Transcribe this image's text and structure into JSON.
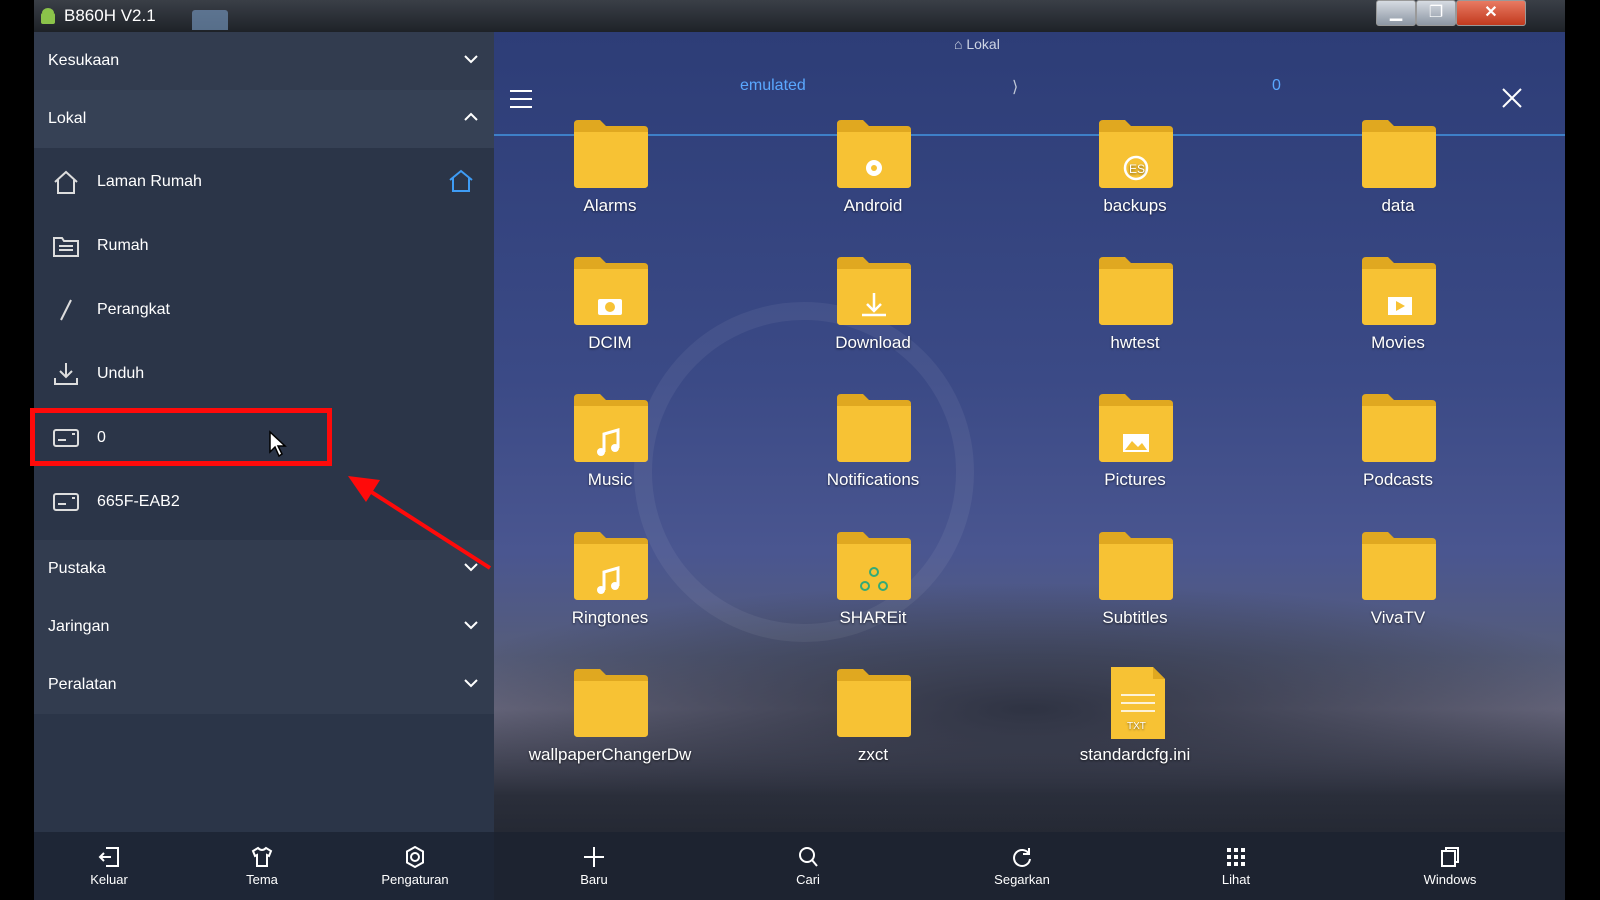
{
  "window": {
    "title": "B860H V2.1",
    "controls": {
      "minimize": "▁",
      "maximize": "❐",
      "close": "✕"
    }
  },
  "sidebar": {
    "sections": [
      {
        "label": "Kesukaan",
        "expanded": false
      },
      {
        "label": "Lokal",
        "expanded": true
      },
      {
        "label": "Pustaka",
        "expanded": false
      },
      {
        "label": "Jaringan",
        "expanded": false
      },
      {
        "label": "Peralatan",
        "expanded": false
      }
    ],
    "items": [
      {
        "label": "Laman Rumah",
        "icon": "home-icon"
      },
      {
        "label": "Rumah",
        "icon": "folder-list-icon"
      },
      {
        "label": "Perangkat",
        "icon": "slash-icon"
      },
      {
        "label": "Unduh",
        "icon": "download-icon"
      },
      {
        "label": "0",
        "icon": "storage-icon",
        "highlighted": true
      },
      {
        "label": "665F-EAB2",
        "icon": "storage-icon"
      }
    ],
    "bottom_bar": [
      {
        "label": "Keluar",
        "icon": "exit-icon"
      },
      {
        "label": "Tema",
        "icon": "shirt-icon"
      },
      {
        "label": "Pengaturan",
        "icon": "gear-icon"
      }
    ]
  },
  "main": {
    "path_tabs": "Lokal",
    "breadcrumb": {
      "first": "emulated",
      "separator": "⟩",
      "current": "0"
    },
    "files": [
      {
        "name": "Alarms",
        "badge": ""
      },
      {
        "name": "Android",
        "badge": "gear"
      },
      {
        "name": "backups",
        "badge": "es"
      },
      {
        "name": "data",
        "badge": ""
      },
      {
        "name": "DCIM",
        "badge": "camera"
      },
      {
        "name": "Download",
        "badge": "download"
      },
      {
        "name": "hwtest",
        "badge": ""
      },
      {
        "name": "Movies",
        "badge": "play"
      },
      {
        "name": "Music",
        "badge": "note"
      },
      {
        "name": "Notifications",
        "badge": ""
      },
      {
        "name": "Pictures",
        "badge": "image"
      },
      {
        "name": "Podcasts",
        "badge": ""
      },
      {
        "name": "Ringtones",
        "badge": "note"
      },
      {
        "name": "SHAREit",
        "badge": "share"
      },
      {
        "name": "Subtitles",
        "badge": ""
      },
      {
        "name": "VivaTV",
        "badge": ""
      },
      {
        "name": "wallpaperChangerDw",
        "badge": ""
      },
      {
        "name": "zxct",
        "badge": ""
      },
      {
        "name": "standardcfg.ini",
        "badge": "txt-file"
      }
    ],
    "bottom_bar": [
      {
        "label": "Baru",
        "icon": "plus-icon"
      },
      {
        "label": "Cari",
        "icon": "search-icon"
      },
      {
        "label": "Segarkan",
        "icon": "refresh-icon"
      },
      {
        "label": "Lihat",
        "icon": "grid-icon"
      },
      {
        "label": "Windows",
        "icon": "windows-icon"
      }
    ]
  },
  "colors": {
    "accent": "#3e80c8",
    "folder": "#f7c234",
    "highlight": "#ff0a0a"
  }
}
